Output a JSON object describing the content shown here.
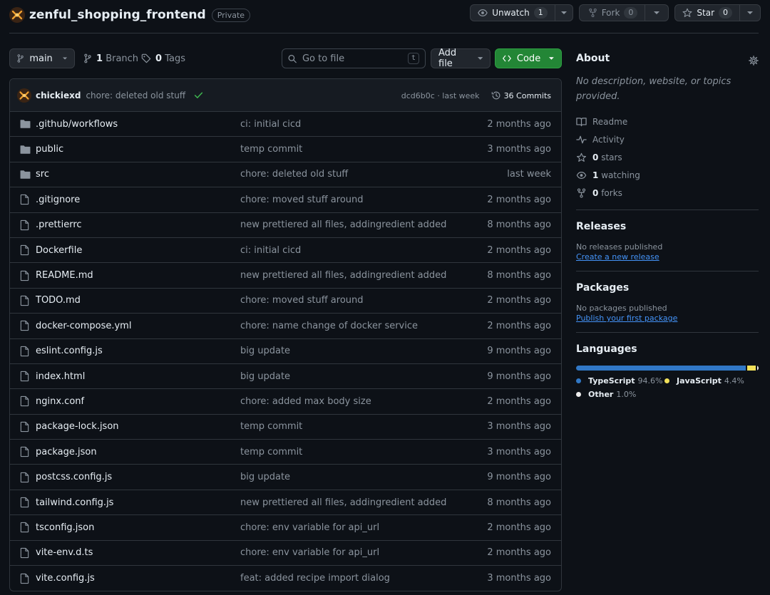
{
  "header": {
    "repo_name": "zenful_shopping_frontend",
    "visibility": "Private",
    "unwatch_label": "Unwatch",
    "watch_count": "1",
    "fork_label": "Fork",
    "fork_count": "0",
    "star_label": "Star",
    "star_count": "0"
  },
  "toolbar": {
    "branch": "main",
    "branch_count": "1",
    "branch_label": "Branch",
    "tag_count": "0",
    "tag_label": "Tags",
    "search_placeholder": "Go to file",
    "search_shortcut": "t",
    "add_file_label": "Add file",
    "code_label": "Code"
  },
  "latest_commit": {
    "author": "chickiexd",
    "message": "chore: deleted old stuff",
    "hash_time": "dcd6b0c · last week",
    "commits_label": "36 Commits"
  },
  "files": [
    {
      "name": ".github/workflows",
      "type": "folder",
      "commit": "ci: initial cicd",
      "date": "2 months ago"
    },
    {
      "name": "public",
      "type": "folder",
      "commit": "temp commit",
      "date": "3 months ago"
    },
    {
      "name": "src",
      "type": "folder",
      "commit": "chore: deleted old stuff",
      "date": "last week"
    },
    {
      "name": ".gitignore",
      "type": "file",
      "commit": "chore: moved stuff around",
      "date": "2 months ago"
    },
    {
      "name": ".prettierrc",
      "type": "file",
      "commit": "new prettiered all files, addingredient added",
      "date": "8 months ago"
    },
    {
      "name": "Dockerfile",
      "type": "file",
      "commit": "ci: initial cicd",
      "date": "2 months ago"
    },
    {
      "name": "README.md",
      "type": "file",
      "commit": "new prettiered all files, addingredient added",
      "date": "8 months ago"
    },
    {
      "name": "TODO.md",
      "type": "file",
      "commit": "chore: moved stuff around",
      "date": "2 months ago"
    },
    {
      "name": "docker-compose.yml",
      "type": "file",
      "commit": "chore: name change of docker service",
      "date": "2 months ago"
    },
    {
      "name": "eslint.config.js",
      "type": "file",
      "commit": "big update",
      "date": "9 months ago"
    },
    {
      "name": "index.html",
      "type": "file",
      "commit": "big update",
      "date": "9 months ago"
    },
    {
      "name": "nginx.conf",
      "type": "file",
      "commit": "chore: added max body size",
      "date": "2 months ago"
    },
    {
      "name": "package-lock.json",
      "type": "file",
      "commit": "temp commit",
      "date": "3 months ago"
    },
    {
      "name": "package.json",
      "type": "file",
      "commit": "temp commit",
      "date": "3 months ago"
    },
    {
      "name": "postcss.config.js",
      "type": "file",
      "commit": "big update",
      "date": "9 months ago"
    },
    {
      "name": "tailwind.config.js",
      "type": "file",
      "commit": "new prettiered all files, addingredient added",
      "date": "8 months ago"
    },
    {
      "name": "tsconfig.json",
      "type": "file",
      "commit": "chore: env variable for api_url",
      "date": "2 months ago"
    },
    {
      "name": "vite-env.d.ts",
      "type": "file",
      "commit": "chore: env variable for api_url",
      "date": "2 months ago"
    },
    {
      "name": "vite.config.js",
      "type": "file",
      "commit": "feat: added recipe import dialog",
      "date": "3 months ago"
    }
  ],
  "about": {
    "title": "About",
    "description": "No description, website, or topics provided.",
    "readme": "Readme",
    "activity": "Activity",
    "stars_count": "0",
    "stars_label": "stars",
    "watching_count": "1",
    "watching_label": "watching",
    "forks_count": "0",
    "forks_label": "forks"
  },
  "releases": {
    "title": "Releases",
    "note": "No releases published",
    "link": "Create a new release"
  },
  "packages": {
    "title": "Packages",
    "note": "No packages published",
    "link": "Publish your first package"
  },
  "languages": {
    "title": "Languages",
    "items": [
      {
        "name": "TypeScript",
        "pct": "94.6%",
        "value": 94.6,
        "color": "#3178c6"
      },
      {
        "name": "JavaScript",
        "pct": "4.4%",
        "value": 4.4,
        "color": "#f1e05a"
      },
      {
        "name": "Other",
        "pct": "1.0%",
        "value": 1.0,
        "color": "#ededed"
      }
    ]
  },
  "colors": {
    "background": "#0d1117",
    "accent_green": "#238636",
    "link_blue": "#4493f8",
    "check_green": "#3fb950"
  }
}
